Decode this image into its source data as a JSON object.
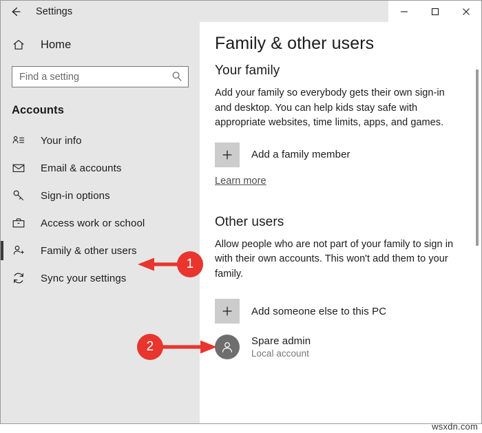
{
  "window": {
    "title": "Settings",
    "back_icon": "back-arrow-icon",
    "controls": [
      {
        "name": "minimize",
        "icon": "minimize-icon"
      },
      {
        "name": "maximize",
        "icon": "maximize-icon"
      },
      {
        "name": "close",
        "icon": "close-icon"
      }
    ]
  },
  "sidebar": {
    "home": {
      "label": "Home",
      "icon": "home-icon"
    },
    "search": {
      "placeholder": "Find a setting",
      "value": "",
      "icon": "search-icon"
    },
    "category": "Accounts",
    "items": [
      {
        "label": "Your info",
        "icon": "user-card-icon",
        "selected": false
      },
      {
        "label": "Email & accounts",
        "icon": "envelope-icon",
        "selected": false
      },
      {
        "label": "Sign-in options",
        "icon": "key-icon",
        "selected": false
      },
      {
        "label": "Access work or school",
        "icon": "briefcase-icon",
        "selected": false
      },
      {
        "label": "Family & other users",
        "icon": "user-plus-icon",
        "selected": true
      },
      {
        "label": "Sync your settings",
        "icon": "sync-icon",
        "selected": false
      }
    ]
  },
  "main": {
    "page_title": "Family & other users",
    "family": {
      "heading": "Your family",
      "description": "Add your family so everybody gets their own sign-in and desktop. You can help kids stay safe with appropriate websites, time limits, apps, and games.",
      "add_button_label": "Add a family member",
      "add_button_icon": "plus-icon",
      "learn_more": "Learn more"
    },
    "other_users": {
      "heading": "Other users",
      "description": "Allow people who are not part of your family to sign in with their own accounts. This won't add them to your family.",
      "add_button_label": "Add someone else to this PC",
      "add_button_icon": "plus-icon",
      "accounts": [
        {
          "name": "Spare admin",
          "type": "Local account",
          "avatar_icon": "person-avatar-icon"
        }
      ]
    }
  },
  "annotations": [
    {
      "number": "1",
      "arrow_direction": "left",
      "target": "Family & other users"
    },
    {
      "number": "2",
      "arrow_direction": "right",
      "target": "Add someone else to this PC"
    }
  ],
  "watermark": "wsxdn.com",
  "colors": {
    "accent_red": "#e8352e",
    "sidebar_bg": "#e6e6e6",
    "content_bg": "#ffffff",
    "plus_box": "#cccccc",
    "avatar": "#6e6e6e",
    "selection_bar": "#3b3b3b"
  }
}
